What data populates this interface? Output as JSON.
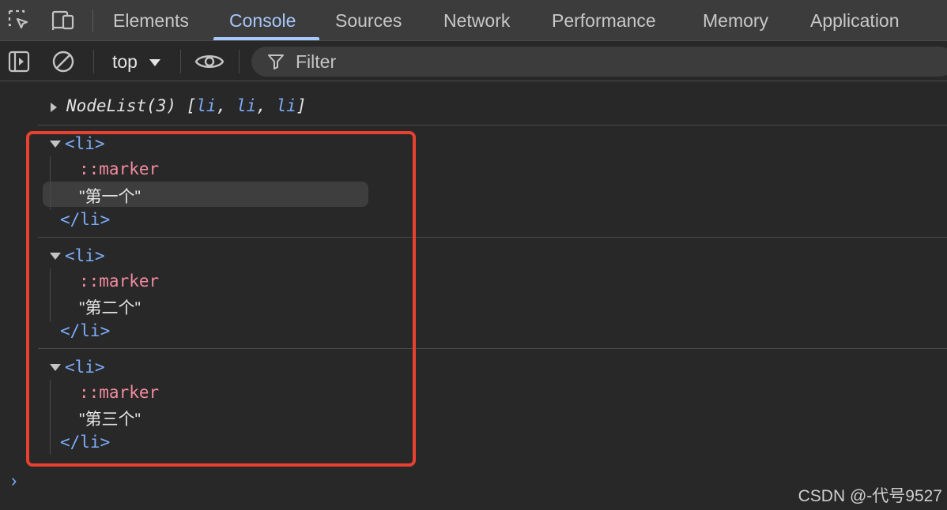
{
  "tabs": {
    "items": [
      "Elements",
      "Console",
      "Sources",
      "Network",
      "Performance",
      "Memory",
      "Application"
    ],
    "active": "Console"
  },
  "toolbar": {
    "context": "top",
    "filter_placeholder": "Filter"
  },
  "console": {
    "nodelist": {
      "label": "NodeList(3)",
      "open_bracket": "[",
      "items": [
        "li",
        "li",
        "li"
      ],
      "sep": ", ",
      "close_bracket": "]"
    },
    "elements": [
      {
        "open_tag": "<li>",
        "pseudo": "::marker",
        "text": "\"第一个\"",
        "close_tag": "</li>"
      },
      {
        "open_tag": "<li>",
        "pseudo": "::marker",
        "text": "\"第二个\"",
        "close_tag": "</li>"
      },
      {
        "open_tag": "<li>",
        "pseudo": "::marker",
        "text": "\"第三个\"",
        "close_tag": "</li>"
      }
    ],
    "prompt": "›"
  },
  "watermark": "CSDN @-代号9527",
  "colors": {
    "accent": "#a8c7fa",
    "tag": "#7cacf8",
    "pseudo": "#f28b9e",
    "highlight_box": "#e8412f",
    "background": "#282828"
  },
  "icons": [
    "inspect-element-icon",
    "device-toggle-icon",
    "sidebar-toggle-icon",
    "clear-console-icon",
    "live-expression-eye-icon",
    "filter-funnel-icon"
  ]
}
